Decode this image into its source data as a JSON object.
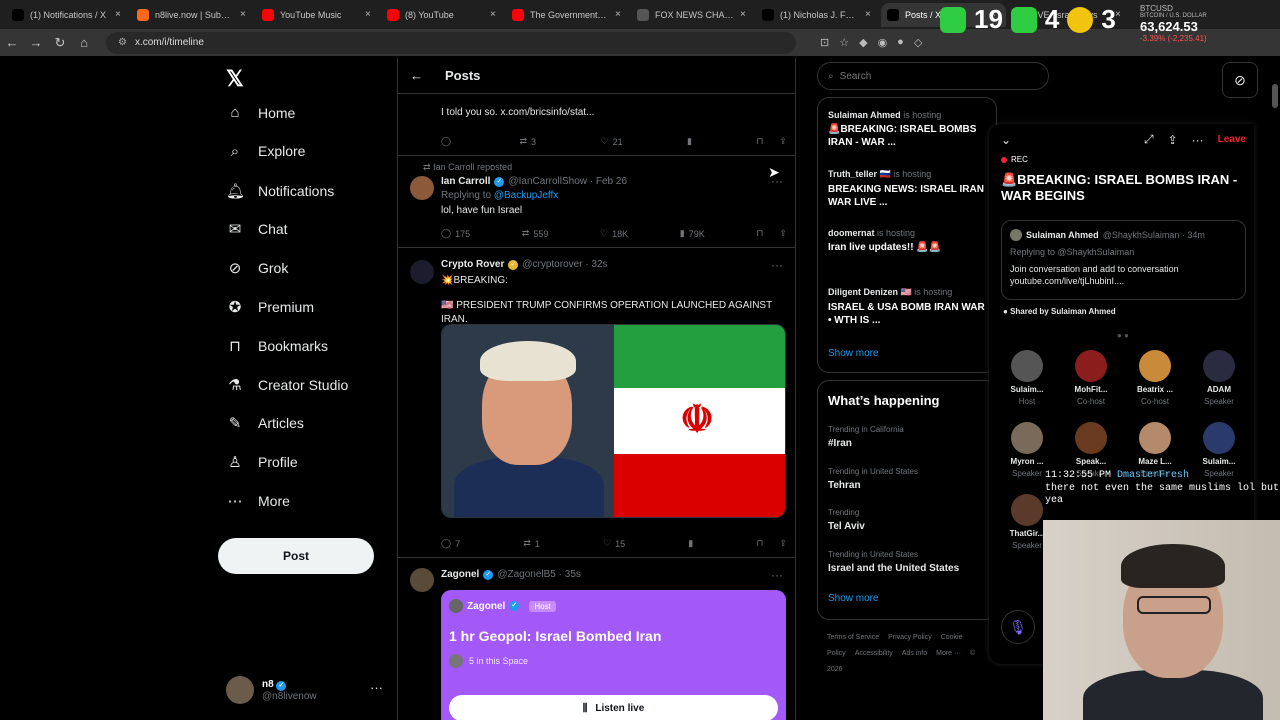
{
  "browser": {
    "tabs": [
      {
        "title": "(1) Notifications / X",
        "icon": "x-logo-icon",
        "color": "#000000"
      },
      {
        "title": "n8live.now | Substack",
        "icon": "substack-icon",
        "color": "#ff6719"
      },
      {
        "title": "YouTube Music",
        "icon": "youtube-music-icon",
        "color": "#ff0000"
      },
      {
        "title": "(8) YouTube",
        "icon": "youtube-icon",
        "color": "#ff0000"
      },
      {
        "title": "The Government just",
        "icon": "youtube-icon",
        "color": "#ff0000"
      },
      {
        "title": "FOX NEWS CHANNEL",
        "icon": "globe-icon",
        "color": "#555555"
      },
      {
        "title": "(1) Nicholas J. Fuente",
        "icon": "x-logo-icon",
        "color": "#000000"
      },
      {
        "title": "Posts / X",
        "icon": "x-logo-icon",
        "color": "#000000",
        "active": true
      },
      {
        "title": "LIVE: Israel says",
        "icon": "youtube-icon",
        "color": "#ff0000"
      }
    ],
    "url": "x.com/i/timeline"
  },
  "overlay": {
    "counter_a": "19",
    "counter_b": "4",
    "counter_c": "3",
    "ticker_symbol": "BTCUSD",
    "ticker_name": "BITCOIN / U.S. DOLLAR",
    "ticker_price": "63,624.53",
    "ticker_change": "-3.39% (-2,235.41)"
  },
  "nav": {
    "items": [
      {
        "label": "Home",
        "icon": "home-icon"
      },
      {
        "label": "Explore",
        "icon": "search-icon"
      },
      {
        "label": "Notifications",
        "icon": "bell-icon"
      },
      {
        "label": "Chat",
        "icon": "mail-icon"
      },
      {
        "label": "Grok",
        "icon": "grok-icon"
      },
      {
        "label": "Premium",
        "icon": "premium-icon"
      },
      {
        "label": "Bookmarks",
        "icon": "bookmark-icon"
      },
      {
        "label": "Creator Studio",
        "icon": "flask-icon"
      },
      {
        "label": "Articles",
        "icon": "articles-icon"
      },
      {
        "label": "Profile",
        "icon": "person-icon"
      },
      {
        "label": "More",
        "icon": "more-icon"
      }
    ],
    "post_label": "Post",
    "user_name": "n8",
    "user_handle": "@n8livenow"
  },
  "feed": {
    "title": "Posts",
    "posts": [
      {
        "text": "I told you so. x.com/bricsinfo/stat...",
        "replies": "",
        "reposts": "3",
        "likes": "21",
        "views": ""
      },
      {
        "repost_by": "Ian Carroll reposted",
        "name": "Ian Carroll",
        "handle": "@IanCarrollShow · Feb 26",
        "reply_prefix": "Replying to",
        "reply_to": "@BackupJeffx",
        "text": "lol, have fun Israel",
        "replies": "175",
        "reposts": "559",
        "likes": "18K",
        "views": "79K"
      },
      {
        "name": "Crypto Rover",
        "handle": "@cryptorover · 32s",
        "line1": "💥BREAKING:",
        "text": "🇺🇸 PRESIDENT TRUMP CONFIRMS OPERATION LAUNCHED AGAINST IRAN.",
        "replies": "7",
        "reposts": "1",
        "likes": "15",
        "views": ""
      },
      {
        "name": "Zagonel",
        "handle": "@ZagonelB5 · 35s",
        "space_host": "Zagonel",
        "space_badge": "Host",
        "space_title": "1 hr Geopol: Israel Bombed Iran",
        "space_count": "5 in this Space",
        "listen_label": "Listen live"
      }
    ]
  },
  "right": {
    "search_placeholder": "Search",
    "spaces": [
      {
        "host": "Sulaiman Ahmed",
        "status": "is hosting",
        "title": "🚨BREAKING: ISRAEL BOMBS IRAN - WAR ..."
      },
      {
        "host": "Truth_teller 🇷🇺",
        "status": "is hosting",
        "title": "BREAKING NEWS: ISRAEL IRAN WAR LIVE ..."
      },
      {
        "host": "doomernat",
        "status": "is hosting",
        "title": "Iran live updates!! 🚨🚨"
      },
      {
        "host": "Diligent Denizen 🇺🇸",
        "status": "is hosting",
        "title": "ISRAEL & USA BOMB IRAN WAR • WTH IS ..."
      }
    ],
    "show_more": "Show more",
    "happening_title": "What’s happening",
    "trends": [
      {
        "context": "Trending in California",
        "topic": "#Iran"
      },
      {
        "context": "Trending in United States",
        "topic": "Tehran"
      },
      {
        "context": "Trending",
        "topic": "Tel Aviv"
      },
      {
        "context": "Trending in United States",
        "topic": "Israel and the United States"
      }
    ],
    "show_more_2": "Show more",
    "footer": [
      "Terms of Service",
      "Privacy Policy",
      "Cookie Policy",
      "Accessibility",
      "Ads info",
      "More ···",
      "© 2026"
    ]
  },
  "space_panel": {
    "leave": "Leave",
    "rec": "REC",
    "title": "🚨BREAKING: ISRAEL BOMBS IRAN - WAR BEGINS",
    "shared_name": "Sulaiman Ahmed",
    "shared_handle": "@ShaykhSulaiman · 34m",
    "shared_reply": "Replying to @ShaykhSulaiman",
    "shared_text": "Join conversation and add to conversation youtube.com/live/tjLhubinI....",
    "shared_by": "Shared by Sulaiman Ahmed",
    "listeners": [
      {
        "name": "Sulaim...",
        "role": "Host",
        "color": "#555555"
      },
      {
        "name": "MohFit...",
        "role": "Co-host",
        "color": "#8b1d1d"
      },
      {
        "name": "Beatrix ...",
        "role": "Co-host",
        "color": "#c98a3a"
      },
      {
        "name": "ADAM",
        "role": "Speaker",
        "color": "#2a2a40"
      },
      {
        "name": "Myron ...",
        "role": "Speaker",
        "color": "#7a6a5a"
      },
      {
        "name": "Speak...",
        "role": "Speaker",
        "color": "#6a3a20"
      },
      {
        "name": "Maze L...",
        "role": "Speaker",
        "color": "#b48a6a"
      },
      {
        "name": "Sulaim...",
        "role": "Speaker",
        "color": "#2a3a6a"
      },
      {
        "name": "ThatGir...",
        "role": "Speaker",
        "color": "#5a3a2a"
      }
    ]
  },
  "chat_overlay": {
    "time": "11:32:55 PM",
    "user": "DmasterFresh",
    "message": "there not even the same muslims lol but yea"
  }
}
